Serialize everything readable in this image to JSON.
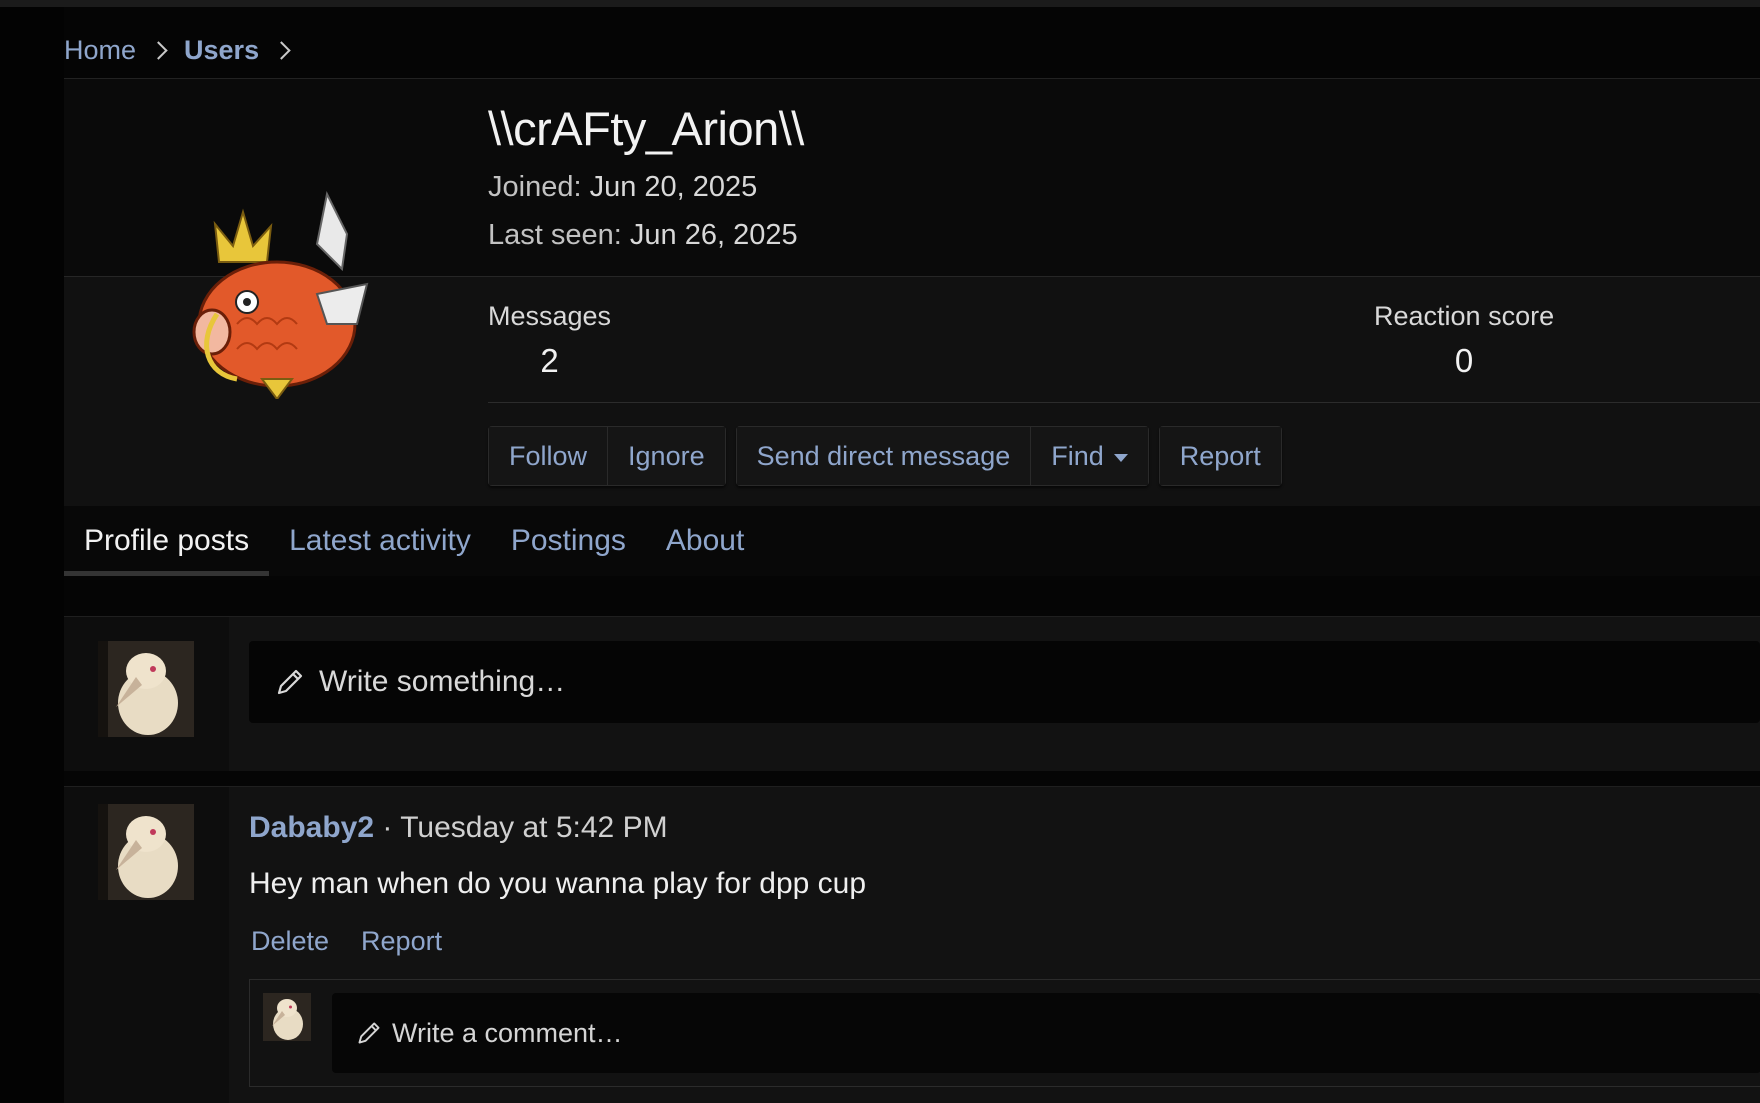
{
  "breadcrumb": {
    "home": "Home",
    "users": "Users"
  },
  "profile": {
    "username": "\\\\crAFty_Arion\\\\",
    "joined_label": "Joined:",
    "joined_value": "Jun 20, 2025",
    "last_seen_label": "Last seen:",
    "last_seen_value": "Jun 26, 2025",
    "avatar_icon": "magikarp-avatar",
    "stats": {
      "messages_label": "Messages",
      "messages_value": "2",
      "reaction_label": "Reaction score",
      "reaction_value": "0"
    },
    "actions": {
      "follow": "Follow",
      "ignore": "Ignore",
      "send_dm": "Send direct message",
      "find": "Find",
      "report": "Report"
    }
  },
  "tabs": [
    {
      "label": "Profile posts",
      "active": true
    },
    {
      "label": "Latest activity",
      "active": false
    },
    {
      "label": "Postings",
      "active": false
    },
    {
      "label": "About",
      "active": false
    }
  ],
  "composer": {
    "placeholder": "Write something…",
    "icon": "pencil-icon"
  },
  "posts": [
    {
      "author": "Dababy2",
      "separator": "·",
      "time": "Tuesday at 5:42 PM",
      "body": "Hey man when do you wanna play for dpp cup",
      "delete_label": "Delete",
      "report_label": "Report",
      "comment_placeholder": "Write a comment…"
    }
  ],
  "colors": {
    "link": "#8fa6cc",
    "background": "#050505",
    "panel": "#121212",
    "text": "#e6e6e6"
  }
}
